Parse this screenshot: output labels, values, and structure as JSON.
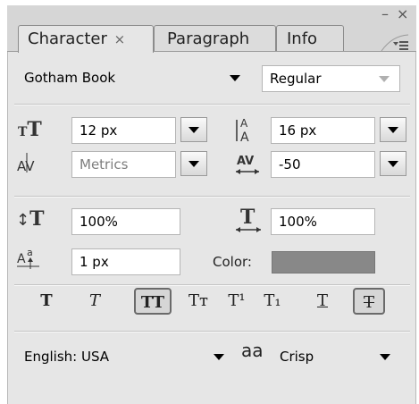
{
  "panel": {
    "window_controls": {
      "minimize": "–",
      "close": "×"
    }
  },
  "tabs": [
    {
      "label": "Character",
      "close_glyph": "×"
    },
    {
      "label": "Paragraph"
    },
    {
      "label": "Info"
    }
  ],
  "font": {
    "family": "Gotham Book",
    "style": "Regular"
  },
  "size": {
    "font_size": "12 px",
    "leading": "16 px",
    "kerning": "Metrics",
    "tracking": "-50"
  },
  "scale": {
    "vertical": "100%",
    "horizontal": "100%",
    "baseline_shift": "1 px",
    "color_label": "Color:",
    "color_value": "#888888"
  },
  "style_buttons": {
    "faux_bold": "T",
    "faux_italic": "T",
    "all_caps": "TT",
    "small_caps": "Tт",
    "superscript": "T¹",
    "subscript": "T₁",
    "underline": "T",
    "strikethrough": "T",
    "pressed": [
      "all_caps",
      "strikethrough"
    ]
  },
  "language": {
    "value": "English: USA",
    "antialias_icon_text": "aa",
    "antialias": "Crisp"
  }
}
